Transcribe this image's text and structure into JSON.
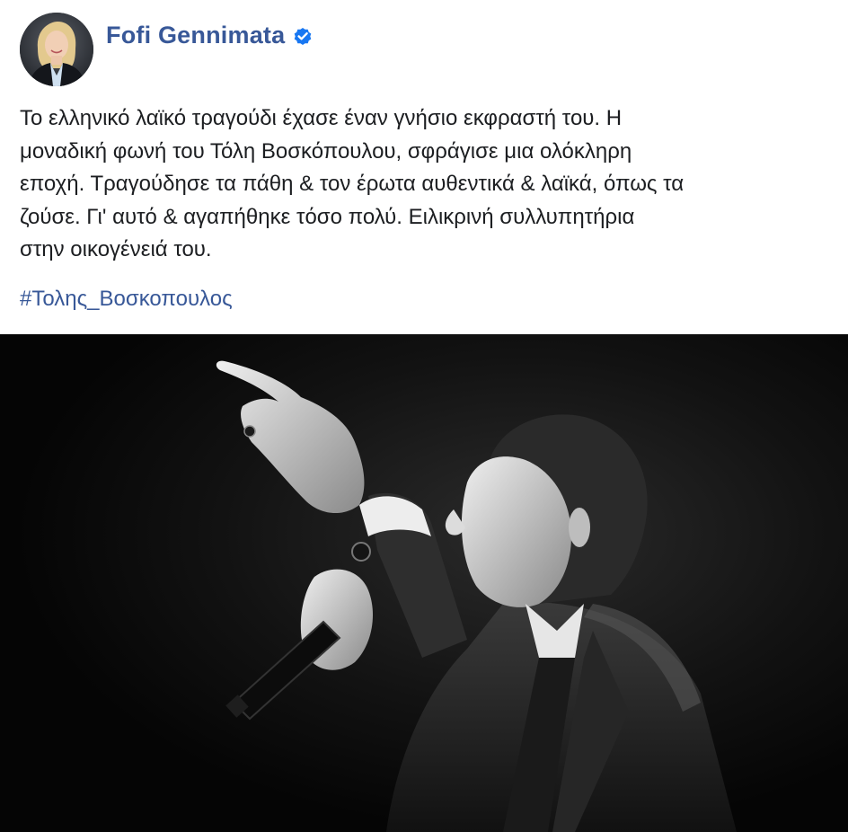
{
  "post": {
    "author": {
      "name": "Fofi Gennimata",
      "verified": true,
      "avatar_icon": "profile-photo-woman",
      "verified_icon": "verified-badge-icon",
      "badge_color": "#1877f2"
    },
    "text": "Το ελληνικό λαϊκό τραγούδι έχασε έναν γνήσιο εκφραστή του. Η\nμοναδική φωνή του Τόλη Βοσκόπουλου, σφράγισε μια ολόκληρη\nεποχή. Τραγούδησε τα πάθη & τον έρωτα αυθεντικά & λαϊκά, όπως τα\nζούσε. Γι' αυτό & αγαπήθηκε τόσο πολύ. Ειλικρινή συλλυπητήρια\nστην οικογένειά του.",
    "hashtag": "#Τολης_Βοσκοπουλος",
    "photo": {
      "description_icon": "black-and-white-singer-photo"
    }
  },
  "colors": {
    "link": "#385898",
    "text": "#1c1e21",
    "background": "#ffffff"
  }
}
